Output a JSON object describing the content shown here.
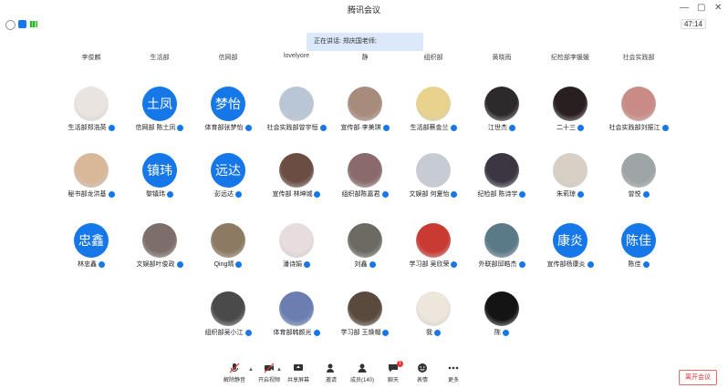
{
  "window": {
    "title": "腾讯会议",
    "timer": "47:14"
  },
  "speaking_banner": "正在讲话: 郑庆国老师;",
  "partial_row": [
    "李俊麟",
    "生活部",
    "信网部",
    "lovelyore",
    "静",
    "组织部",
    "黄晓雨",
    "纪检部李媛媛",
    "社会实践部",
    "体育部"
  ],
  "participants": [
    {
      "name": "生活部郑浩英",
      "avatar_text": "",
      "color": "#e9e4df"
    },
    {
      "name": "信网部 陈土凤",
      "avatar_text": "土凤",
      "color": "#1677e8"
    },
    {
      "name": "体育部张梦怡",
      "avatar_text": "梦怡",
      "color": "#1677e8"
    },
    {
      "name": "社会实践部曾宇恒",
      "avatar_text": "",
      "color": "#b9c6d6"
    },
    {
      "name": "宣传部·李美琪",
      "avatar_text": "",
      "color": "#a78c7c"
    },
    {
      "name": "生活部蔡金兰",
      "avatar_text": "",
      "color": "#e9d28e"
    },
    {
      "name": "江世杰",
      "avatar_text": "",
      "color": "#2d2a2c"
    },
    {
      "name": "二十三",
      "avatar_text": "",
      "color": "#2a1f1f"
    },
    {
      "name": "社会实践部刘振江",
      "avatar_text": "",
      "color": "#c98b85"
    },
    {
      "name": "秘书部龙洪基",
      "avatar_text": "",
      "color": "#d9b89a"
    },
    {
      "name": "黎镇玮",
      "avatar_text": "镇玮",
      "color": "#1677e8"
    },
    {
      "name": "彭远达",
      "avatar_text": "远达",
      "color": "#1677e8"
    },
    {
      "name": "宣传部 林坤城",
      "avatar_text": "",
      "color": "#6b4d44"
    },
    {
      "name": "组织部陈嘉君",
      "avatar_text": "",
      "color": "#8a6a6a"
    },
    {
      "name": "文娱部 何夏怡",
      "avatar_text": "",
      "color": "#c7cbd4"
    },
    {
      "name": "纪检部 陈诗宇",
      "avatar_text": "",
      "color": "#3b3642"
    },
    {
      "name": "朱莉琼",
      "avatar_text": "",
      "color": "#d8d0c4"
    },
    {
      "name": "曾悦",
      "avatar_text": "",
      "color": "#9fa4a6"
    },
    {
      "name": "林忠鑫",
      "avatar_text": "忠鑫",
      "color": "#1677e8"
    },
    {
      "name": "文娱部叶俊政",
      "avatar_text": "",
      "color": "#7d6e6a"
    },
    {
      "name": "Qing晴",
      "avatar_text": "",
      "color": "#8c7a63"
    },
    {
      "name": "潘诗娟",
      "avatar_text": "",
      "color": "#e7dcde"
    },
    {
      "name": "刘鑫",
      "avatar_text": "",
      "color": "#6c6a62"
    },
    {
      "name": "学习部 吴欣荣",
      "avatar_text": "",
      "color": "#c93b32"
    },
    {
      "name": "外联部邱皓杰",
      "avatar_text": "",
      "color": "#5b7a88"
    },
    {
      "name": "宣传部杨康炎",
      "avatar_text": "康炎",
      "color": "#1677e8"
    },
    {
      "name": "陈佳",
      "avatar_text": "陈佳",
      "color": "#1677e8"
    },
    {
      "name": "组织部吴小江",
      "avatar_text": "",
      "color": "#4a4a4a"
    },
    {
      "name": "体育部韩颜光",
      "avatar_text": "",
      "color": "#6a7fb0"
    },
    {
      "name": "学习部 王焕帽",
      "avatar_text": "",
      "color": "#5a4a3e"
    },
    {
      "name": "我",
      "avatar_text": "",
      "color": "#ece6dc"
    },
    {
      "name": "陈",
      "avatar_text": "",
      "color": "#141414"
    }
  ],
  "toolbar": {
    "mute": "解除静音",
    "video": "开启视频",
    "share": "共享屏幕",
    "invite": "邀请",
    "members": "成员(140)",
    "chat": "聊天",
    "reaction": "表情",
    "more": "更多",
    "chat_badge": "1",
    "leave": "离开会议"
  }
}
